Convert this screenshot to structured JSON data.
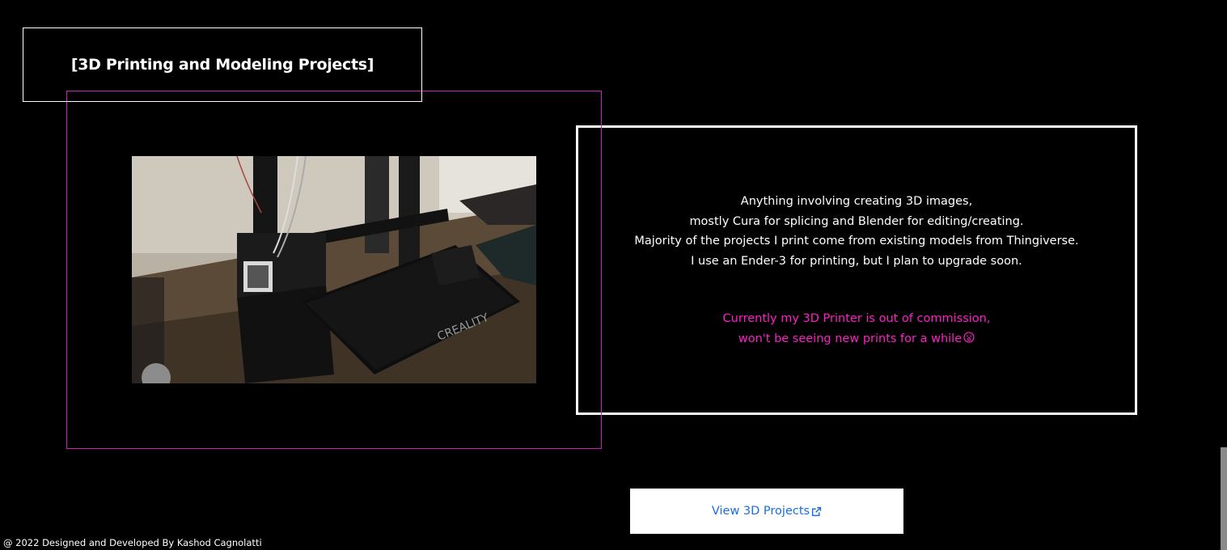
{
  "section": {
    "title": "[3D Printing and Modeling Projects]"
  },
  "photo": {
    "alt": "Ender-3 3D printer on a desk",
    "bed_brand_text": "CREALITY"
  },
  "description": {
    "lines": [
      "Anything involving creating 3D images,",
      "mostly Cura for splicing and Blender for editing/creating.",
      "Majority of the projects I print come from existing models from Thingiverse.",
      "I use an Ender-3 for printing, but I plan to upgrade soon."
    ],
    "notice": [
      "Currently my 3D Printer is out of commission,",
      "won't be seeing new prints for a while"
    ],
    "notice_icon": "shocked-face-icon"
  },
  "cta": {
    "label": "View 3D Projects",
    "icon": "external-link-icon"
  },
  "footer": {
    "text": "@ 2022 Designed and Developed By Kashod Cagnolatti"
  },
  "colors": {
    "background": "#000000",
    "accent_magenta": "#ff1fc7",
    "frame_magenta": "#c822b8",
    "link_blue": "#1a6fe0",
    "white": "#ffffff"
  }
}
